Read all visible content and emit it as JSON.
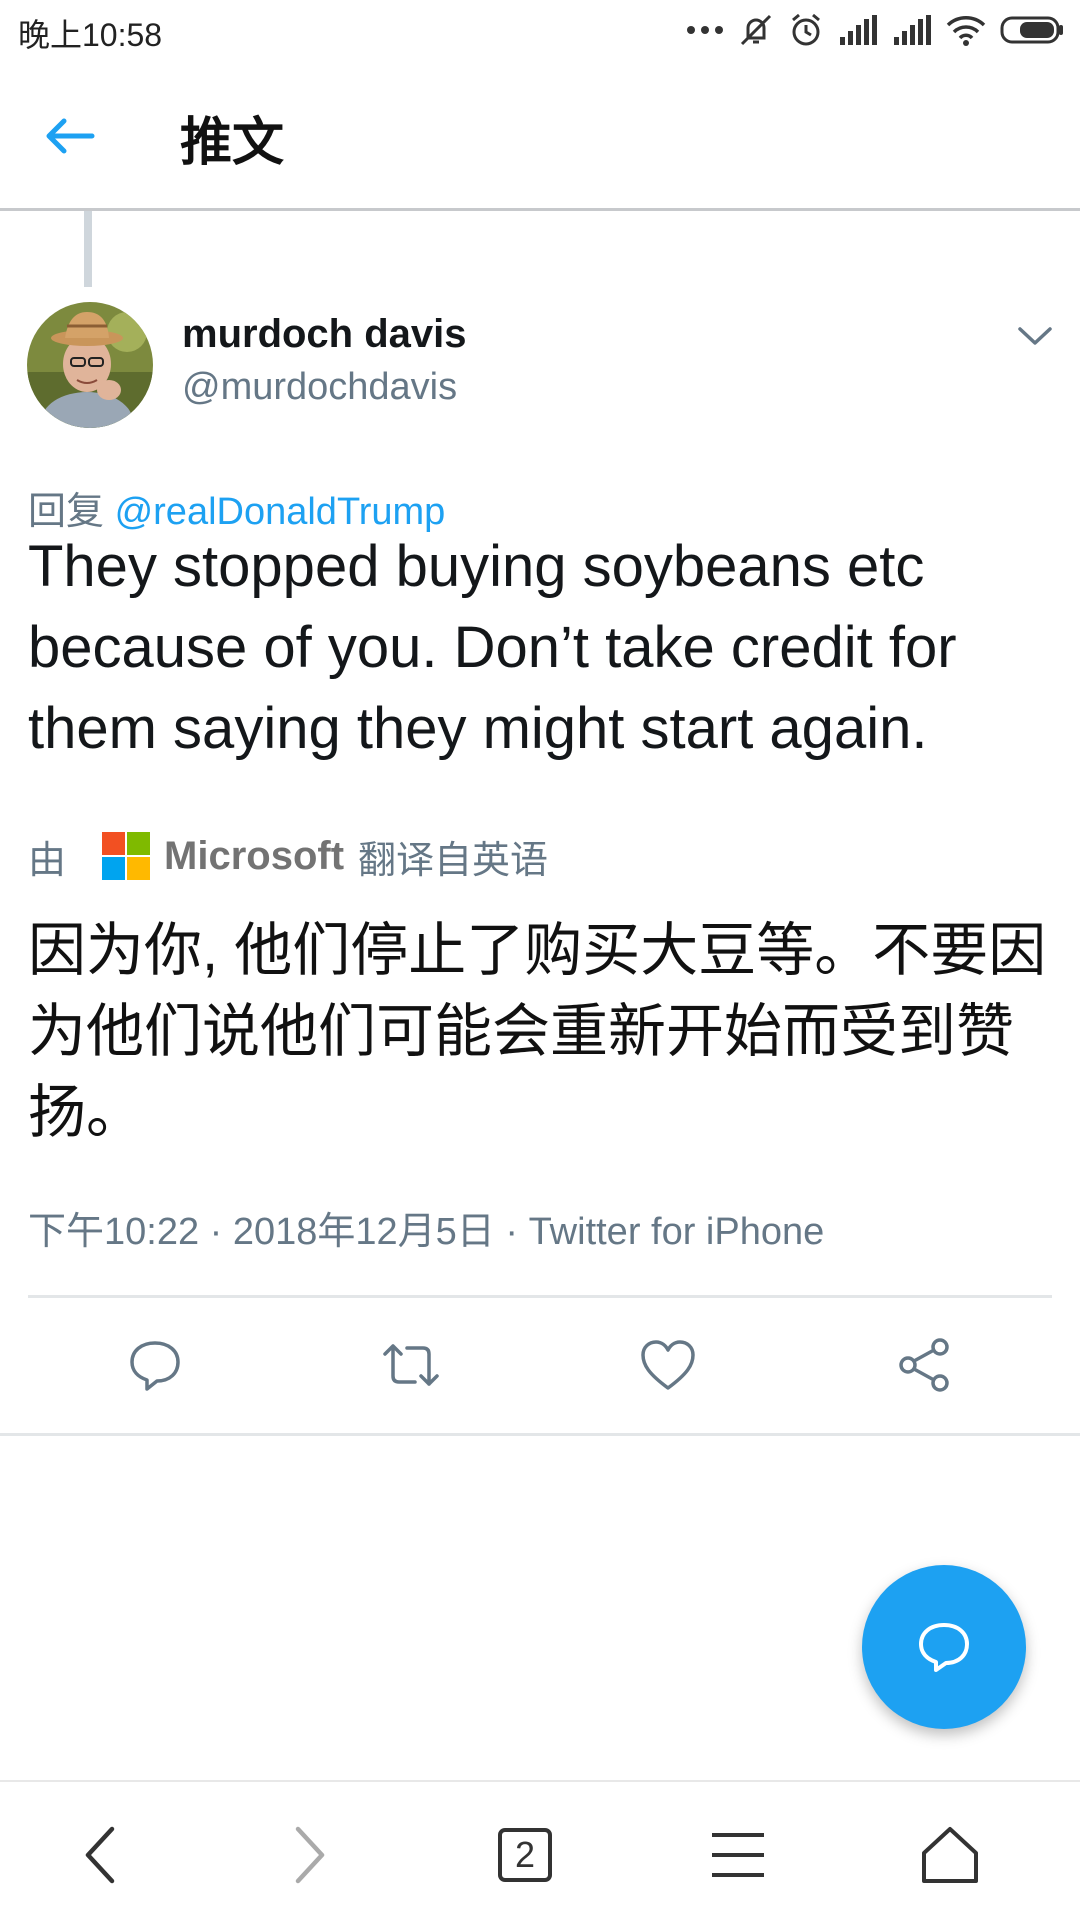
{
  "status": {
    "time": "晚上10:58"
  },
  "header": {
    "title": "推文"
  },
  "tweet": {
    "display_name": "murdoch davis",
    "handle": "@murdochdavis",
    "reply_prefix": "回复",
    "reply_to": "@realDonaldTrump",
    "text": "They stopped buying soybeans etc because of you. Don’t take credit for them saying they might start again.",
    "translation": {
      "by_label": "由",
      "provider": "Microsoft",
      "suffix": "翻译自英语",
      "text": "因为你, 他们停止了购买大豆等。不要因为他们说他们可能会重新开始而受到赞扬。"
    },
    "meta": "下午10:22 · 2018年12月5日 · Twitter for iPhone"
  },
  "browser": {
    "tab_count": "2"
  },
  "icons": {
    "back": "arrow-left-icon",
    "chevron": "chevron-down-icon",
    "reply": "reply-icon",
    "retweet": "retweet-icon",
    "like": "heart-icon",
    "share": "share-icon",
    "compose": "compose-reply-icon"
  },
  "colors": {
    "accent": "#1da1f2",
    "secondary_text": "#657786",
    "primary_text": "#14171a"
  }
}
